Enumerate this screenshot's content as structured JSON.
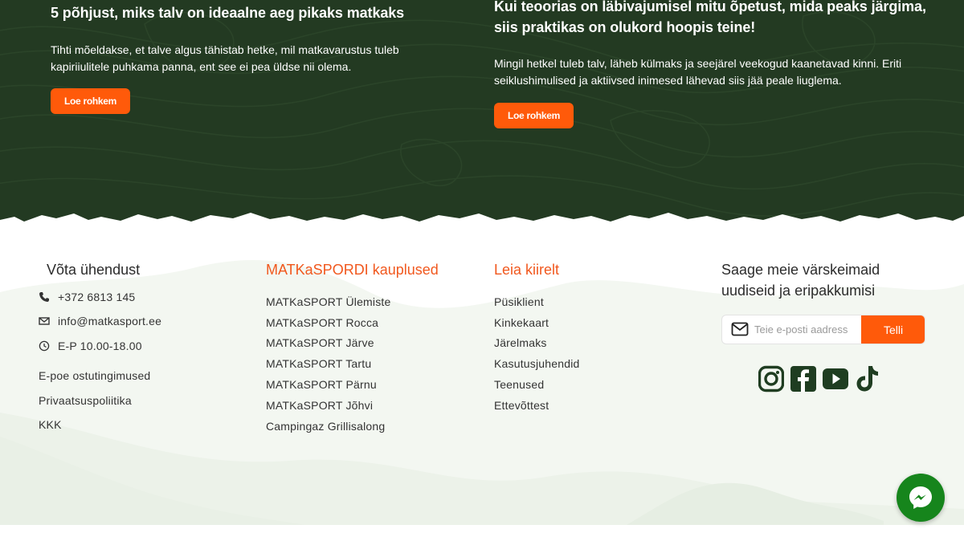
{
  "blog": {
    "cards": [
      {
        "title": "5 põhjust, miks talv on ideaalne aeg pikaks matkaks",
        "text": "Tihti mõeldakse, et talve algus tähistab hetke, mil matkavarustus tuleb kapiriiulitele puhkama panna, ent see ei pea üldse nii olema.",
        "button": "Loe rohkem"
      },
      {
        "title": "Kui teoorias on läbivajumisel mitu õpetust, mida peaks järgima, siis praktikas on olukord hoopis teine!",
        "text": "Mingil hetkel tuleb talv, läheb külmaks ja seejärel veekogud kaanetavad kinni. Eriti seiklushimulised ja aktiivsed inimesed lähevad siis jää peale liuglema.",
        "button": "Loe rohkem"
      }
    ]
  },
  "footer": {
    "contact": {
      "heading": "Võta ühendust",
      "phone": "+372 6813 145",
      "email": "info@matkasport.ee",
      "hours": "E-P 10.00-18.00",
      "links": [
        "E-poe ostutingimused",
        "Privaatsuspoliitika",
        "KKK"
      ]
    },
    "stores": {
      "heading": "MATKaSPORDI kauplused",
      "links": [
        "MATKaSPORT Ülemiste",
        "MATKaSPORT Rocca",
        "MATKaSPORT Järve",
        "MATKaSPORT Tartu",
        "MATKaSPORT Pärnu",
        "MATKaSPORT Jõhvi",
        "Campingaz Grillisalong"
      ]
    },
    "quick": {
      "heading": "Leia kiirelt",
      "links": [
        "Püsiklient",
        "Kinkekaart",
        "Järelmaks",
        "Kasutusjuhendid",
        "Teenused",
        "Ettevõttest"
      ]
    },
    "newsletter": {
      "heading": "Saage meie värskeimaid uudiseid ja eripakkumisi",
      "placeholder": "Teie e-posti aadress",
      "button": "Telli"
    },
    "socials": [
      "instagram-icon",
      "facebook-icon",
      "youtube-icon",
      "tiktok-icon"
    ]
  },
  "messenger": "messenger-icon",
  "colors": {
    "accent": "#ff5a0a",
    "heading_orange": "#f1581e",
    "dark_green": "#233a22",
    "social_green": "#1f3d21",
    "messenger_green": "#16851c"
  }
}
